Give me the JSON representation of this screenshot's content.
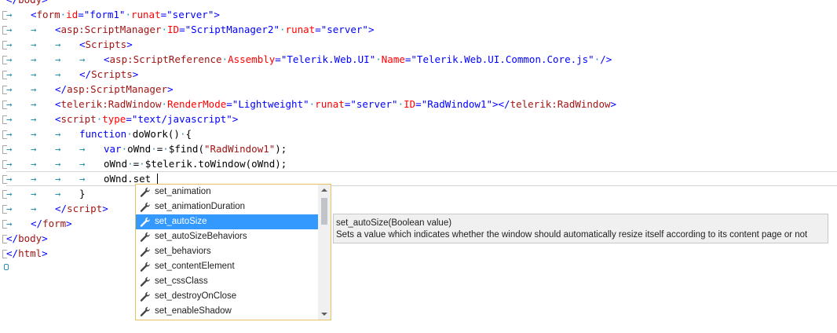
{
  "editor": {
    "line_top_fragment": "</body>",
    "lines": [
      {
        "indent": 1,
        "tokens": [
          [
            "brk",
            "<"
          ],
          [
            "tag",
            "form"
          ],
          [
            "ws",
            " "
          ],
          [
            "attr",
            "id"
          ],
          [
            "brk",
            "="
          ],
          [
            "val",
            "\"form1\""
          ],
          [
            "ws",
            " "
          ],
          [
            "attr",
            "runat"
          ],
          [
            "brk",
            "="
          ],
          [
            "val",
            "\"server\""
          ],
          [
            "brk",
            ">"
          ]
        ]
      },
      {
        "indent": 2,
        "tokens": [
          [
            "brk",
            "<"
          ],
          [
            "tag",
            "asp:ScriptManager"
          ],
          [
            "ws",
            " "
          ],
          [
            "attr",
            "ID"
          ],
          [
            "brk",
            "="
          ],
          [
            "val",
            "\"ScriptManager2\""
          ],
          [
            "ws",
            " "
          ],
          [
            "attr",
            "runat"
          ],
          [
            "brk",
            "="
          ],
          [
            "val",
            "\"server\""
          ],
          [
            "brk",
            ">"
          ]
        ]
      },
      {
        "indent": 3,
        "tokens": [
          [
            "brk",
            "<"
          ],
          [
            "tag",
            "Scripts"
          ],
          [
            "brk",
            ">"
          ]
        ]
      },
      {
        "indent": 4,
        "tokens": [
          [
            "brk",
            "<"
          ],
          [
            "tag",
            "asp:ScriptReference"
          ],
          [
            "ws",
            " "
          ],
          [
            "attr",
            "Assembly"
          ],
          [
            "brk",
            "="
          ],
          [
            "val",
            "\"Telerik.Web.UI\""
          ],
          [
            "ws",
            " "
          ],
          [
            "attr",
            "Name"
          ],
          [
            "brk",
            "="
          ],
          [
            "val",
            "\"Telerik.Web.UI.Common.Core.js\""
          ],
          [
            "ws",
            " "
          ],
          [
            "brk",
            "/>"
          ]
        ]
      },
      {
        "indent": 3,
        "tokens": [
          [
            "brk",
            "</"
          ],
          [
            "tag",
            "Scripts"
          ],
          [
            "brk",
            ">"
          ]
        ]
      },
      {
        "indent": 2,
        "tokens": [
          [
            "brk",
            "</"
          ],
          [
            "tag",
            "asp:ScriptManager"
          ],
          [
            "brk",
            ">"
          ]
        ]
      },
      {
        "indent": 2,
        "tokens": [
          [
            "brk",
            "<"
          ],
          [
            "tag",
            "telerik:RadWindow"
          ],
          [
            "ws",
            " "
          ],
          [
            "attr",
            "RenderMode"
          ],
          [
            "brk",
            "="
          ],
          [
            "val",
            "\"Lightweight\""
          ],
          [
            "ws",
            " "
          ],
          [
            "attr",
            "runat"
          ],
          [
            "brk",
            "="
          ],
          [
            "val",
            "\"server\""
          ],
          [
            "ws",
            " "
          ],
          [
            "attr",
            "ID"
          ],
          [
            "brk",
            "="
          ],
          [
            "val",
            "\"RadWindow1\""
          ],
          [
            "brk",
            "></"
          ],
          [
            "tag",
            "telerik:RadWindow"
          ],
          [
            "brk",
            ">"
          ]
        ]
      },
      {
        "indent": 2,
        "tokens": [
          [
            "brk",
            "<"
          ],
          [
            "tag",
            "script"
          ],
          [
            "ws",
            " "
          ],
          [
            "attr",
            "type"
          ],
          [
            "brk",
            "="
          ],
          [
            "val",
            "\"text/javascript\""
          ],
          [
            "brk",
            ">"
          ]
        ]
      },
      {
        "indent": 3,
        "tokens": [
          [
            "kw",
            "function"
          ],
          [
            "ws",
            " "
          ],
          [
            "txt",
            "doWork()"
          ],
          [
            "ws",
            " "
          ],
          [
            "txt",
            "{"
          ]
        ]
      },
      {
        "indent": 4,
        "tokens": [
          [
            "kw",
            "var"
          ],
          [
            "ws",
            " "
          ],
          [
            "txt",
            "oWnd"
          ],
          [
            "ws",
            " "
          ],
          [
            "txt",
            "="
          ],
          [
            "ws",
            " "
          ],
          [
            "txt",
            "$find("
          ],
          [
            "str",
            "\"RadWindow1\""
          ],
          [
            "txt",
            ");"
          ]
        ]
      },
      {
        "indent": 4,
        "tokens": [
          [
            "txt",
            "oWnd"
          ],
          [
            "ws",
            " "
          ],
          [
            "txt",
            "="
          ],
          [
            "ws",
            " "
          ],
          [
            "txt",
            "$telerik.toWindow(oWnd);"
          ]
        ]
      },
      {
        "indent": 4,
        "tokens": [
          [
            "txt",
            "oWnd.set_"
          ]
        ],
        "current": true
      },
      {
        "indent": 3,
        "tokens": [
          [
            "txt",
            "}"
          ]
        ]
      },
      {
        "indent": 2,
        "tokens": [
          [
            "brk",
            "</"
          ],
          [
            "tag",
            "script"
          ],
          [
            "brk",
            ">"
          ]
        ]
      },
      {
        "indent": 1,
        "tokens": [
          [
            "brk",
            "</"
          ],
          [
            "tag",
            "form"
          ],
          [
            "brk",
            ">"
          ]
        ]
      },
      {
        "indent": 0,
        "tokens": [
          [
            "brk",
            "</"
          ],
          [
            "tag",
            "body"
          ],
          [
            "brk",
            ">"
          ]
        ]
      },
      {
        "indent": 0,
        "tokens": [
          [
            "brk",
            "</"
          ],
          [
            "tag",
            "html"
          ],
          [
            "brk",
            ">"
          ]
        ]
      }
    ]
  },
  "completion": {
    "selected_index": 2,
    "items": [
      "set_animation",
      "set_animationDuration",
      "set_autoSize",
      "set_autoSizeBehaviors",
      "set_behaviors",
      "set_contentElement",
      "set_cssClass",
      "set_destroyOnClose",
      "set_enableShadow"
    ],
    "item_icon": "wrench-icon"
  },
  "tooltip": {
    "signature": "set_autoSize(Boolean value)",
    "description": "Sets a value which indicates whether the window should automatically resize itself according to its content page or not"
  },
  "colors": {
    "tag": "#a31515",
    "attribute": "#ff0000",
    "value": "#0000ff",
    "selection": "#3399ff"
  }
}
